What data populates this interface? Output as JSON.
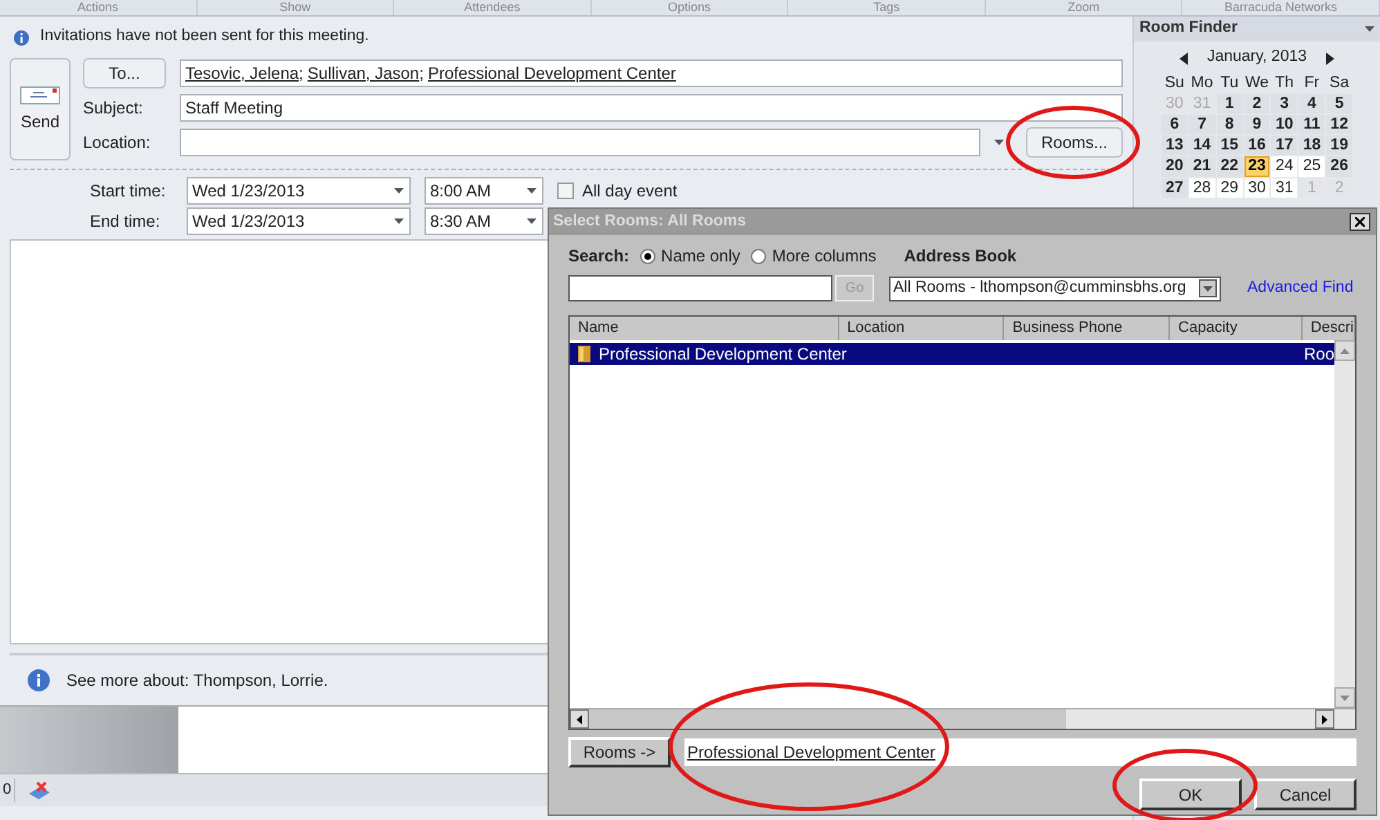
{
  "ribbon_groups": [
    "Actions",
    "Show",
    "Attendees",
    "Options",
    "Tags",
    "Zoom",
    "Barracuda Networks"
  ],
  "info_bar": {
    "text": "Invitations have not been sent for this meeting."
  },
  "send_button": {
    "label": "Send"
  },
  "to_button": {
    "label": "To..."
  },
  "recipients": [
    {
      "text": "Tesovic,  Jelena",
      "separator": ";"
    },
    {
      "text": "Sullivan,  Jason",
      "separator": ";"
    },
    {
      "text": "Professional Development Center"
    }
  ],
  "subject": {
    "label": "Subject:",
    "value": "Staff Meeting"
  },
  "location": {
    "label": "Location:"
  },
  "rooms_button": {
    "label": "Rooms..."
  },
  "start": {
    "label": "Start time:",
    "date": "Wed 1/23/2013",
    "time": "8:00 AM"
  },
  "end": {
    "label": "End time:",
    "date": "Wed 1/23/2013",
    "time": "8:30 AM"
  },
  "all_day": {
    "label": "All day event",
    "checked": false
  },
  "people_pane": {
    "text": "See more about: Thompson,  Lorrie."
  },
  "status_bar": {
    "text": "0"
  },
  "room_finder": {
    "title": "Room Finder",
    "month": "January, 2013",
    "weekdays": [
      "Su",
      "Mo",
      "Tu",
      "We",
      "Th",
      "Fr",
      "Sa"
    ],
    "weeks": [
      [
        {
          "day": "30",
          "kind": "outside",
          "selected": false
        },
        {
          "day": "31",
          "kind": "outside",
          "selected": false
        },
        {
          "day": "1",
          "kind": "busy",
          "selected": false
        },
        {
          "day": "2",
          "kind": "busy",
          "selected": false
        },
        {
          "day": "3",
          "kind": "busy",
          "selected": false
        },
        {
          "day": "4",
          "kind": "busy",
          "selected": false
        },
        {
          "day": "5",
          "kind": "busy",
          "selected": false
        }
      ],
      [
        {
          "day": "6",
          "kind": "busy",
          "selected": false
        },
        {
          "day": "7",
          "kind": "busy",
          "selected": false
        },
        {
          "day": "8",
          "kind": "busy",
          "selected": false
        },
        {
          "day": "9",
          "kind": "busy",
          "selected": false
        },
        {
          "day": "10",
          "kind": "busy",
          "selected": false
        },
        {
          "day": "11",
          "kind": "busy",
          "selected": false
        },
        {
          "day": "12",
          "kind": "busy",
          "selected": false
        }
      ],
      [
        {
          "day": "13",
          "kind": "busy",
          "selected": false
        },
        {
          "day": "14",
          "kind": "busy",
          "selected": false
        },
        {
          "day": "15",
          "kind": "busy",
          "selected": false
        },
        {
          "day": "16",
          "kind": "busy",
          "selected": false
        },
        {
          "day": "17",
          "kind": "busy",
          "selected": false
        },
        {
          "day": "18",
          "kind": "busy",
          "selected": false
        },
        {
          "day": "19",
          "kind": "busy",
          "selected": false
        }
      ],
      [
        {
          "day": "20",
          "kind": "busy",
          "selected": false
        },
        {
          "day": "21",
          "kind": "busy",
          "selected": false
        },
        {
          "day": "22",
          "kind": "busy",
          "selected": false
        },
        {
          "day": "23",
          "kind": "busy",
          "selected": true
        },
        {
          "day": "24",
          "kind": "free",
          "selected": false
        },
        {
          "day": "25",
          "kind": "free",
          "selected": false
        },
        {
          "day": "26",
          "kind": "busy",
          "selected": false
        }
      ],
      [
        {
          "day": "27",
          "kind": "busy",
          "selected": false
        },
        {
          "day": "28",
          "kind": "free",
          "selected": false
        },
        {
          "day": "29",
          "kind": "free",
          "selected": false
        },
        {
          "day": "30",
          "kind": "free",
          "selected": false
        },
        {
          "day": "31",
          "kind": "free",
          "selected": false
        },
        {
          "day": "1",
          "kind": "outside",
          "selected": false
        },
        {
          "day": "2",
          "kind": "outside",
          "selected": false
        }
      ]
    ]
  },
  "dialog": {
    "title": "Select Rooms: All Rooms",
    "search_label": "Search:",
    "search_options": [
      {
        "label": "Name only",
        "selected": true
      },
      {
        "label": "More columns",
        "selected": false
      }
    ],
    "go_button": "Go",
    "address_book_label": "Address Book",
    "address_book": "All Rooms - lthompson@cumminsbhs.org",
    "advanced_find": "Advanced Find",
    "columns": [
      "Name",
      "Location",
      "Business Phone",
      "Capacity",
      "Descri"
    ],
    "rows": [
      {
        "name": "Professional Development Center",
        "description": "Roo",
        "selected": true
      }
    ],
    "rooms_button": "Rooms ->",
    "rooms_value": "Professional Development Center",
    "ok": "OK",
    "cancel": "Cancel"
  }
}
